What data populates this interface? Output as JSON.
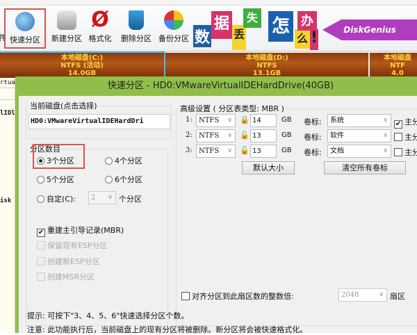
{
  "toolbar": {
    "buttons": [
      {
        "label": "快速分区",
        "icon": "quick-partition-icon"
      },
      {
        "label": "新建分区",
        "icon": "new-partition-icon"
      },
      {
        "label": "格式化",
        "icon": "format-icon"
      },
      {
        "label": "删除分区",
        "icon": "delete-partition-icon"
      },
      {
        "label": "备份分区",
        "icon": "backup-partition-icon"
      }
    ],
    "left_cut": "件"
  },
  "banner": {
    "chars": [
      "数",
      "据",
      "丢",
      "失",
      "怎",
      "么",
      "办",
      "!"
    ],
    "brand": "DiskGenius"
  },
  "disk_map": [
    {
      "name": "本地磁盘(C:)",
      "fs": "NTFS (活动)",
      "size": "14.0GB"
    },
    {
      "name": "本地磁盘(D:)",
      "fs": "NTFS",
      "size": "13.1GB"
    },
    {
      "name": "本地磁盘",
      "fs": "NTF",
      "size": "4.0"
    }
  ],
  "left_pane": {
    "lines": [
      "rtual",
      "lIDl",
      "isk"
    ]
  },
  "dialog": {
    "title": "快速分区 - HD0:VMwareVirtualIDEHardDrive(40GB)",
    "current_disk": {
      "label": "当前磁盘(点击选择)",
      "value": "HD0:VMwareVirtualIDEHardDri"
    },
    "partition_count": {
      "label": "分区数目",
      "options": [
        "3个分区",
        "4个分区",
        "5个分区",
        "6个分区"
      ],
      "selected": "3个分区",
      "custom_label": "自定(C):",
      "custom_value": "2",
      "custom_suffix": "个分区"
    },
    "options": [
      {
        "label": "重建主引导记录(MBR)",
        "checked": true,
        "enabled": true
      },
      {
        "label": "保留现有ESP分区",
        "checked": false,
        "enabled": false
      },
      {
        "label": "创建新ESP分区",
        "checked": false,
        "enabled": false
      },
      {
        "label": "创建MSR分区",
        "checked": false,
        "enabled": false
      }
    ],
    "advanced": {
      "label": "高级设置 ( 分区表类型: MBR )",
      "unit": "GB",
      "vol_label": "卷标:",
      "primary": "主分",
      "rows": [
        {
          "index": "1:",
          "fs": "NTFS",
          "size": "14",
          "locked": true,
          "volume": "系统",
          "primary": true
        },
        {
          "index": "2:",
          "fs": "NTFS",
          "size": "13",
          "locked": false,
          "volume": "软件",
          "primary": false
        },
        {
          "index": "3:",
          "fs": "NTFS",
          "size": "13",
          "locked": false,
          "volume": "文档",
          "primary": false
        }
      ],
      "default_size_btn": "默认大小",
      "clear_labels_btn": "清空所有卷标",
      "align_label": "对齐分区到此扇区数的整数倍:",
      "align_value": "2048",
      "align_unit": "扇区"
    },
    "hint": "提示: 可按下\"3、4、5、6\"快速选择分区个数。",
    "note": "注意: 此功能执行后，当前磁盘上的现有分区将被删除。新分区将会被快速格式化。"
  }
}
